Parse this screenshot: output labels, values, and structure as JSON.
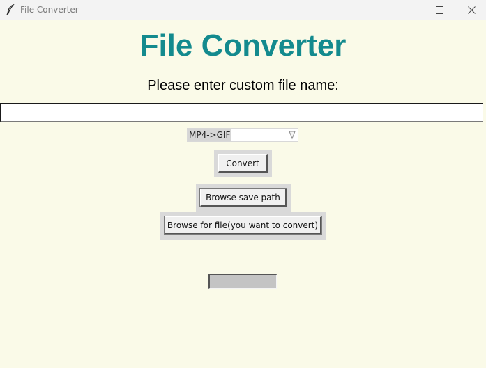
{
  "window": {
    "title": "File Converter"
  },
  "main": {
    "heading": "File Converter",
    "prompt": "Please enter custom file name:",
    "filename_input": {
      "value": "",
      "placeholder": ""
    },
    "conversion_select": {
      "selected": "MP4->GIF"
    },
    "convert_label": "Convert",
    "browse_save_label": "Browse save path",
    "browse_file_label": "Browse for file(you want to convert)",
    "progress": {
      "value": 0
    }
  },
  "colors": {
    "heading": "#138a8e",
    "background": "#fafae8",
    "button_frame": "#d9d9d9"
  },
  "icons": {
    "app": "feather-icon",
    "minimize": "minimize-icon",
    "maximize": "maximize-icon",
    "close": "close-icon",
    "dropdown": "chevron-down-icon"
  }
}
